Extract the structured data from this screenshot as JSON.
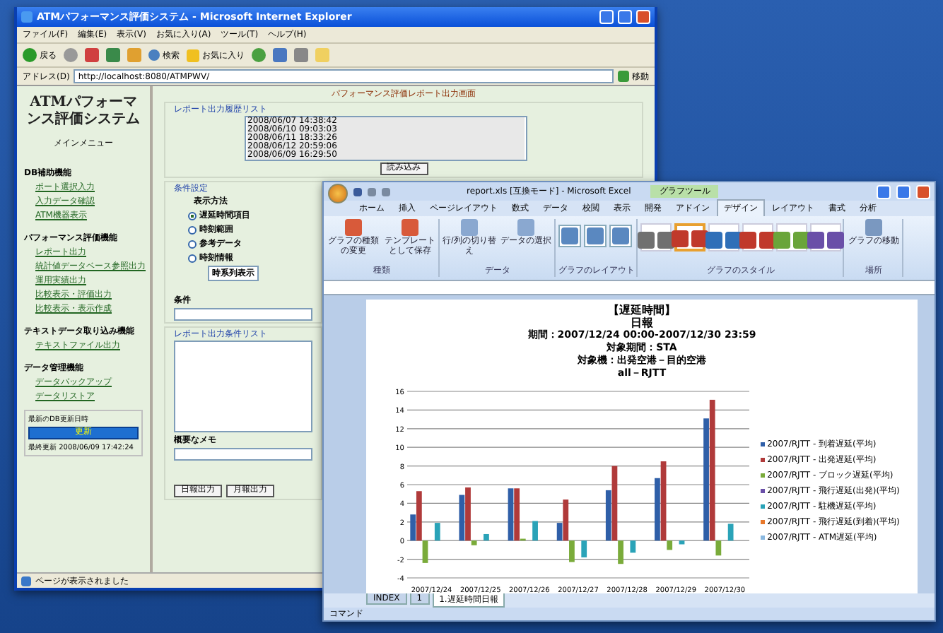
{
  "ie": {
    "title": "ATMパフォーマンス評価システム - Microsoft Internet Explorer",
    "menu": [
      "ファイル(F)",
      "編集(E)",
      "表示(V)",
      "お気に入り(A)",
      "ツール(T)",
      "ヘルプ(H)"
    ],
    "toolbar": {
      "back": "戻る",
      "search": "検索",
      "favorites": "お気に入り"
    },
    "address": {
      "label": "アドレス(D)",
      "value": "http://localhost:8080/ATMPWV/",
      "go": "移動"
    },
    "sidebar": {
      "title": "ATMパフォーマンス評価システム",
      "menu_heading": "メインメニュー",
      "groups": [
        {
          "title": "DB補助機能",
          "links": [
            "ポート選択入力",
            "入力データ確認",
            "ATM機器表示"
          ]
        },
        {
          "title": "パフォーマンス評価機能",
          "links": [
            "レポート出力",
            "統計値データベース参照出力",
            "運用実績出力",
            "比較表示・評価出力",
            "比較表示・表示作成"
          ]
        },
        {
          "title": "テキストデータ取り込み機能",
          "links": [
            "テキストファイル出力"
          ]
        },
        {
          "title": "データ管理機能",
          "links": [
            "データバックアップ",
            "データリストア"
          ]
        }
      ],
      "update_box": {
        "label": "最新のDB更新日時",
        "button": "更新",
        "time": "最終更新 2008/06/09 17:42:24"
      }
    },
    "main": {
      "heading": "パフォーマンス評価レポート出力画面",
      "history_legend": "レポート出力履歴リスト",
      "history": [
        "2008/06/07 14:38:42",
        "2008/06/10 09:03:03",
        "2008/06/11 18:33:26",
        "2008/06/12 20:59:06",
        "2008/06/09 16:29:50"
      ],
      "load_button": "読み込み",
      "settings_legend": "条件設定",
      "method_label": "表示方法",
      "radios": [
        {
          "label": "遅延時間項目",
          "selected": true
        },
        {
          "label": "時刻範囲",
          "selected": false
        },
        {
          "label": "参考データ",
          "selected": false
        },
        {
          "label": "時刻情報",
          "selected": false
        }
      ],
      "select": "時系列表示",
      "condition_label": "条件",
      "output_legend": "レポート出力条件リスト",
      "memo_label": "概要なメモ",
      "buttons": [
        "日報出力",
        "月報出力"
      ]
    },
    "status": "ページが表示されました"
  },
  "excel": {
    "title": "report.xls [互換モード] - Microsoft Excel",
    "context_tab": "グラフツール",
    "tabs": [
      {
        "label": "ホーム",
        "selected": false
      },
      {
        "label": "挿入",
        "selected": false
      },
      {
        "label": "ページレイアウト",
        "selected": false
      },
      {
        "label": "数式",
        "selected": false
      },
      {
        "label": "データ",
        "selected": false
      },
      {
        "label": "校閲",
        "selected": false
      },
      {
        "label": "表示",
        "selected": false
      },
      {
        "label": "開発",
        "selected": false
      },
      {
        "label": "アドイン",
        "selected": false
      },
      {
        "label": "デザイン",
        "selected": true
      },
      {
        "label": "レイアウト",
        "selected": false
      },
      {
        "label": "書式",
        "selected": false
      },
      {
        "label": "分析",
        "selected": false
      }
    ],
    "groups": [
      {
        "name": "種類",
        "buttons": [
          "グラフの種類の変更",
          "テンプレートとして保存"
        ]
      },
      {
        "name": "データ",
        "buttons": [
          "行/列の切り替え",
          "データの選択"
        ]
      }
    ],
    "layout_group": "グラフのレイアウト",
    "style_group": "グラフのスタイル",
    "styles": [
      {
        "color": "#707070",
        "selected": false
      },
      {
        "color": "#c0392b",
        "selected": true
      },
      {
        "color": "#2f6fb8",
        "selected": false
      },
      {
        "color": "#c0392b",
        "selected": false
      },
      {
        "color": "#6aa53a",
        "selected": false
      },
      {
        "color": "#6a4fa8",
        "selected": false
      }
    ],
    "location_group": "場所",
    "move_button": "グラフの移動",
    "chart": {
      "titles": [
        "【遅延時間】",
        "日報",
        "期間：2007/12/24 00:00-2007/12/30 23:59",
        "対象期間：STA",
        "対象機：出発空港－目的空港",
        "all－RJTT"
      ],
      "chart_data": {
        "type": "bar",
        "categories": [
          "2007/12/24",
          "2007/12/25",
          "2007/12/26",
          "2007/12/27",
          "2007/12/28",
          "2007/12/29",
          "2007/12/30"
        ],
        "ylim": [
          -4,
          16
        ],
        "grid": true,
        "yticks": [
          -4,
          -2,
          0,
          2,
          4,
          6,
          8,
          10,
          12,
          14,
          16
        ],
        "series": [
          {
            "name": "2007/RJTT - 到着遅延(平均)",
            "color": "#2f5fa8",
            "values": [
              2.8,
              4.9,
              5.6,
              1.9,
              5.4,
              6.7,
              13.1
            ]
          },
          {
            "name": "2007/RJTT - 出発遅延(平均)",
            "color": "#b03a3a",
            "values": [
              5.3,
              5.7,
              5.6,
              4.4,
              8.0,
              8.5,
              15.1
            ]
          },
          {
            "name": "2007/RJTT - ブロック遅延(平均)",
            "color": "#7aab3a",
            "values": [
              -2.4,
              -0.5,
              0.2,
              -2.3,
              -2.5,
              -1.0,
              -1.6
            ]
          },
          {
            "name": "2007/RJTT - 飛行遅延(出発)(平均)",
            "color": "#6a4fa8",
            "values": [
              null,
              null,
              null,
              null,
              null,
              null,
              null
            ]
          },
          {
            "name": "2007/RJTT - 駐機遅延(平均)",
            "color": "#2aa3b8",
            "values": [
              1.9,
              0.7,
              2.1,
              -1.8,
              -1.3,
              -0.4,
              1.8
            ]
          },
          {
            "name": "2007/RJTT - 飛行遅延(到着)(平均)",
            "color": "#e8782a",
            "values": [
              null,
              null,
              null,
              null,
              null,
              null,
              null
            ]
          },
          {
            "name": "2007/RJTT - ATM遅延(平均)",
            "color": "#8ab8e0",
            "values": [
              null,
              null,
              null,
              null,
              null,
              null,
              null
            ]
          }
        ]
      }
    },
    "sheet_tabs": [
      {
        "label": "INDEX",
        "selected": false
      },
      {
        "label": "1",
        "selected": false
      },
      {
        "label": "1.遅延時間日報",
        "selected": true
      }
    ],
    "status": "コマンド"
  }
}
